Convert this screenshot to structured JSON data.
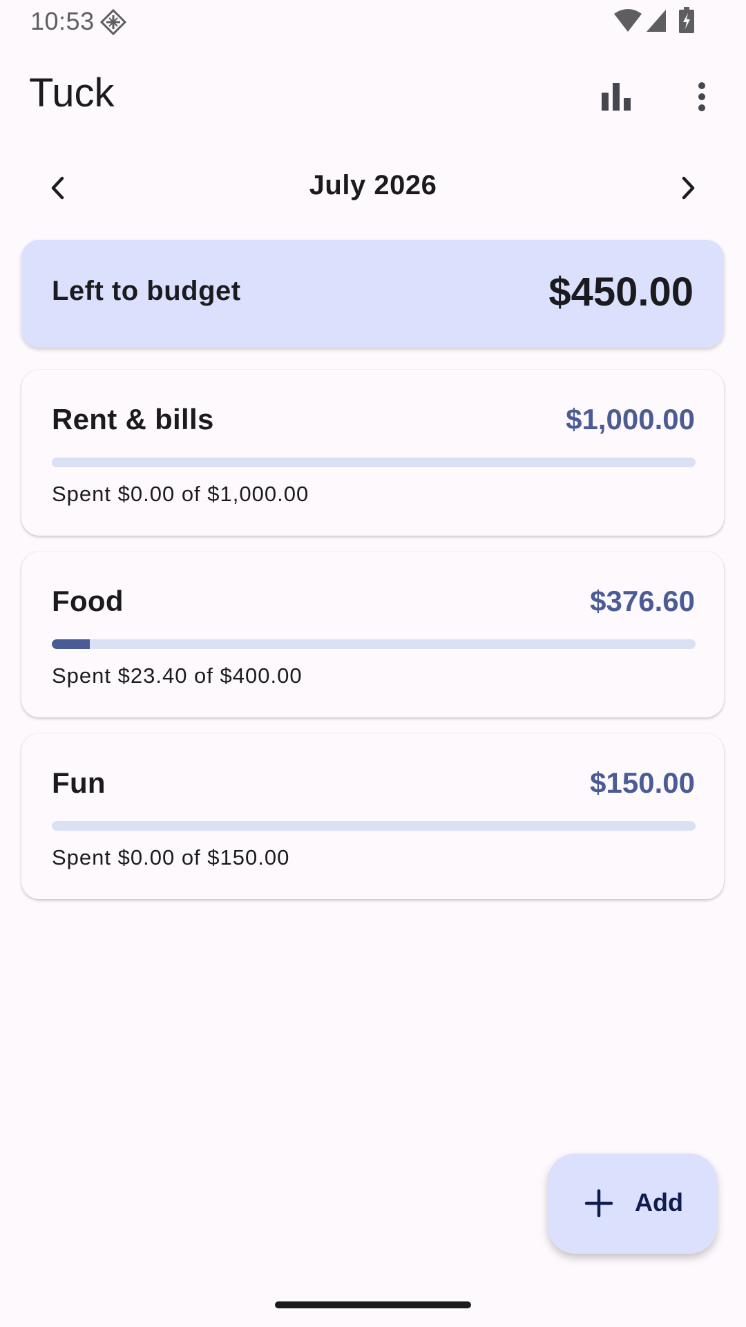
{
  "status_bar": {
    "time": "10:53"
  },
  "app_bar": {
    "title": "Tuck",
    "icons": [
      "bar-chart-icon",
      "more-vert-icon"
    ]
  },
  "month_nav": {
    "label": "July 2026",
    "prev_icon": "chevron-left-icon",
    "next_icon": "chevron-right-icon"
  },
  "summary": {
    "label": "Left to budget",
    "amount": "$450.00"
  },
  "categories": [
    {
      "name": "Rent & bills",
      "amount": "$1,000.00",
      "spent_text": "Spent $0.00 of $1,000.00",
      "progress": 0
    },
    {
      "name": "Food",
      "amount": "$376.60",
      "spent_text": "Spent $23.40 of $400.00",
      "progress": 0.0585
    },
    {
      "name": "Fun",
      "amount": "$150.00",
      "spent_text": "Spent $0.00 of $150.00",
      "progress": 0
    }
  ],
  "fab": {
    "label": "Add",
    "icon": "plus-icon"
  },
  "colors": {
    "background": "#fdf9fd",
    "accent_container": "#dbe1fd",
    "primary": "#4a5b95",
    "progress_track": "#dbe1f5",
    "on_surface": "#1b1b1f"
  }
}
